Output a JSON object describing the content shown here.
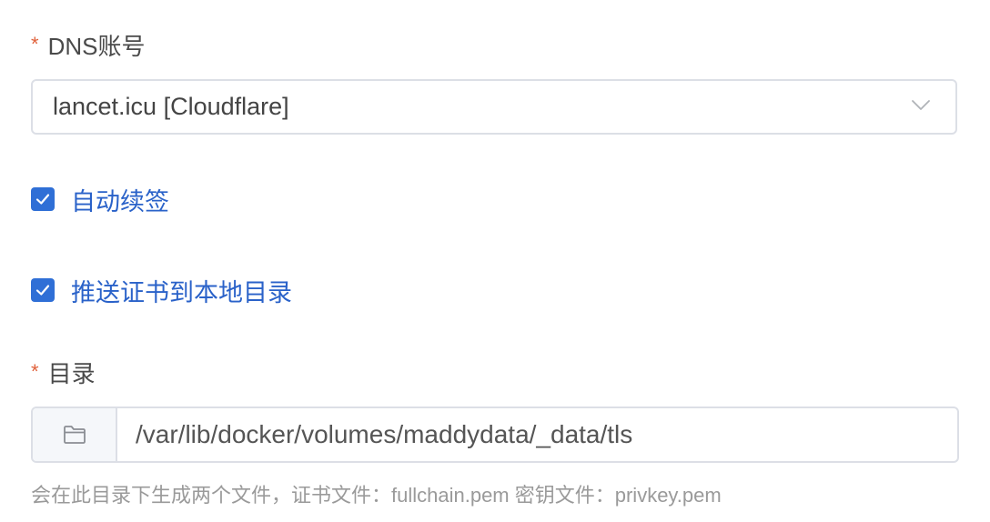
{
  "dns_account": {
    "required_mark": "*",
    "label": "DNS账号",
    "selected_value": "lancet.icu [Cloudflare]"
  },
  "auto_renew": {
    "checked": true,
    "label": "自动续签"
  },
  "push_cert": {
    "checked": true,
    "label": "推送证书到本地目录"
  },
  "directory": {
    "required_mark": "*",
    "label": "目录",
    "value": "/var/lib/docker/volumes/maddydata/_data/tls",
    "hint": "会在此目录下生成两个文件，证书文件：fullchain.pem 密钥文件：privkey.pem"
  },
  "colors": {
    "accent": "#2f6fd6",
    "required": "#e0613b",
    "border": "#dcdfe6"
  },
  "icons": {
    "select_arrow": "chevron-down-icon",
    "checkbox": "checkmark-icon",
    "folder": "folder-icon"
  }
}
